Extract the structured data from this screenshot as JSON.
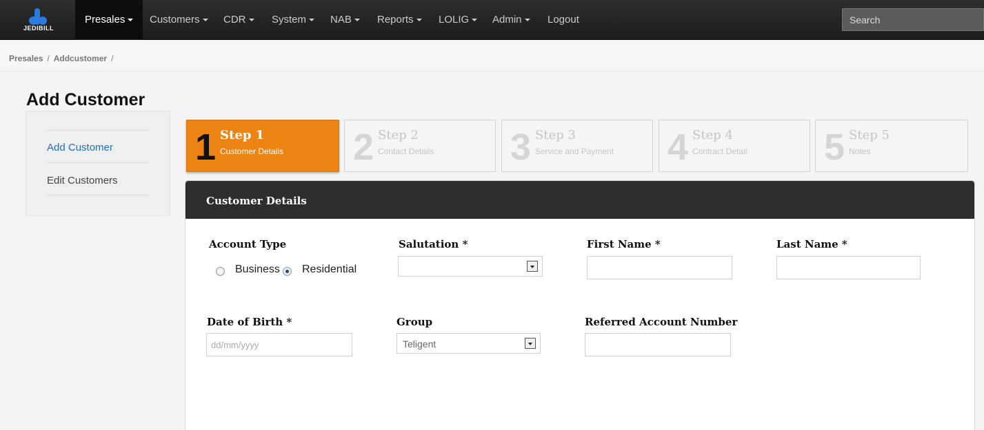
{
  "brand": {
    "logo_text": "JEDIBILL"
  },
  "nav": {
    "items": [
      {
        "label": "Presales",
        "active": true
      },
      {
        "label": "Customers"
      },
      {
        "label": "CDR"
      },
      {
        "label": "System"
      },
      {
        "label": "NAB"
      },
      {
        "label": "Reports"
      },
      {
        "label": "LOLIG"
      },
      {
        "label": "Admin"
      },
      {
        "label": "Logout"
      }
    ],
    "search_placeholder": "Search"
  },
  "breadcrumb": {
    "items": [
      "Presales",
      "Addcustomer"
    ],
    "separator": "/"
  },
  "page": {
    "title": "Add Customer"
  },
  "sidebar": {
    "items": [
      {
        "label": "Add Customer",
        "active": true
      },
      {
        "label": "Edit Customers"
      }
    ]
  },
  "steps": [
    {
      "number": "1",
      "title": "Step 1",
      "subtitle": "Customer Details",
      "active": true
    },
    {
      "number": "2",
      "title": "Step 2",
      "subtitle": "Contact Details"
    },
    {
      "number": "3",
      "title": "Step 3",
      "subtitle": "Service and Payment"
    },
    {
      "number": "4",
      "title": "Step 4",
      "subtitle": "Contract Detail"
    },
    {
      "number": "5",
      "title": "Step 5",
      "subtitle": "Notes"
    }
  ],
  "form": {
    "heading": "Customer Details",
    "account_type": {
      "label": "Account Type",
      "options": [
        "Business",
        "Residential"
      ],
      "selected": "Residential"
    },
    "salutation": {
      "label": "Salutation *",
      "value": ""
    },
    "first_name": {
      "label": "First Name *",
      "value": ""
    },
    "last_name": {
      "label": "Last Name *",
      "value": ""
    },
    "dob": {
      "label": "Date of Birth *",
      "placeholder": "dd/mm/yyyy"
    },
    "group": {
      "label": "Group",
      "value": "Teligent"
    },
    "referred": {
      "label": "Referred Account Number",
      "value": ""
    }
  },
  "colors": {
    "active_step": "#ec8414",
    "link": "#1f6fbf",
    "navbar": "#262626"
  }
}
